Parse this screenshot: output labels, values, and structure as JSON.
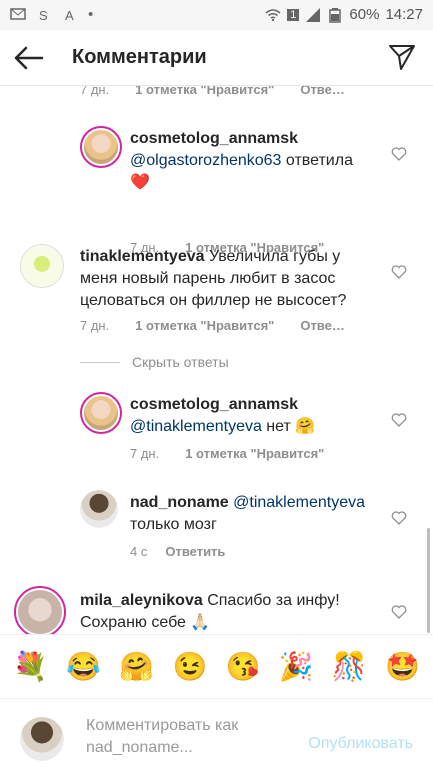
{
  "status_bar": {
    "battery": "60%",
    "time": "14:27",
    "sim": "1"
  },
  "header": {
    "title": "Комментарии"
  },
  "comments": [
    {
      "time": "7 дн.",
      "likes": "1 отметка \"Нравится\"",
      "reply": "Отве…"
    },
    {
      "username": "cosmetolog_annamsk",
      "mention": "@olgastorozhenko63",
      "text": " ответила",
      "emoji": "❤️",
      "time": "7 дн.",
      "likes": "1 отметка \"Нравится\""
    },
    {
      "username": "tinaklementyeva",
      "text": " Увеличила губы у меня новый парень любит в засос целоваться он филлер не высосет?",
      "time": "7 дн.",
      "likes": "1 отметка \"Нравится\"",
      "reply": "Отве…"
    },
    {
      "hide_replies": "Скрыть ответы"
    },
    {
      "username": "cosmetolog_annamsk",
      "mention": "@tinaklementyeva",
      "text": " нет",
      "emoji": "🤗",
      "time": "7 дн.",
      "likes": "1 отметка \"Нравится\""
    },
    {
      "username": "nad_noname",
      "mention": "@tinaklementyeva",
      "text": "только мозг",
      "time": "4 с",
      "reply": "Ответить"
    },
    {
      "username": "mila_aleynikova",
      "text": " Спасибо за инфу! Сохраню себе",
      "emoji": "🙏🏻"
    }
  ],
  "emoji_bar": [
    "💐",
    "😂",
    "🤗",
    "😉",
    "😘",
    "🎉",
    "🎊",
    "🤩"
  ],
  "composer": {
    "placeholder": "Комментировать как nad_noname...",
    "post_label": "Опубликовать"
  },
  "colors": {
    "mention": "#003569",
    "post_disabled": "#b2dffc",
    "heart": "#ed4956"
  }
}
